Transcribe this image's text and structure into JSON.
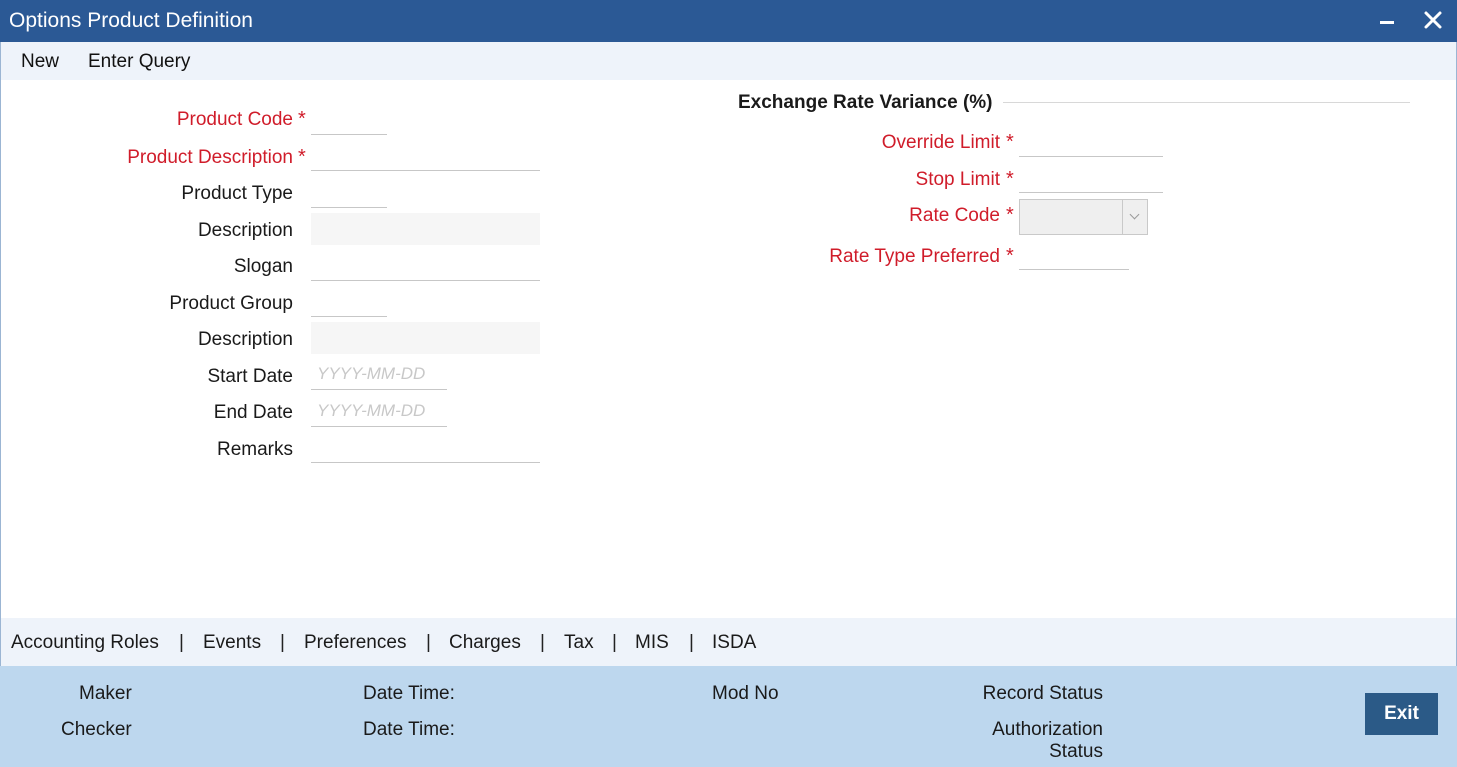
{
  "window": {
    "title": "Options Product Definition",
    "controls": {
      "minimize": "minimize-icon",
      "close": "close-icon"
    }
  },
  "menu": {
    "new": "New",
    "enter_query": "Enter Query"
  },
  "form": {
    "required_marker": "*",
    "product_code": {
      "label": "Product Code",
      "value": ""
    },
    "product_description": {
      "label": "Product Description",
      "value": ""
    },
    "product_type": {
      "label": "Product Type",
      "value": ""
    },
    "type_description": {
      "label": "Description",
      "value": ""
    },
    "slogan": {
      "label": "Slogan",
      "value": ""
    },
    "product_group": {
      "label": "Product Group",
      "value": ""
    },
    "group_description": {
      "label": "Description",
      "value": ""
    },
    "start_date": {
      "label": "Start Date",
      "placeholder": "YYYY-MM-DD",
      "value": ""
    },
    "end_date": {
      "label": "End Date",
      "placeholder": "YYYY-MM-DD",
      "value": ""
    },
    "remarks": {
      "label": "Remarks",
      "value": ""
    }
  },
  "exchange_rate": {
    "section_title": "Exchange Rate Variance (%)",
    "override_limit": {
      "label": "Override Limit",
      "value": ""
    },
    "stop_limit": {
      "label": "Stop Limit",
      "value": ""
    },
    "rate_code": {
      "label": "Rate Code",
      "value": ""
    },
    "rate_type_preferred": {
      "label": "Rate Type Preferred",
      "value": ""
    }
  },
  "tabs": {
    "separator": "|",
    "items": [
      "Accounting Roles",
      "Events",
      "Preferences",
      "Charges",
      "Tax",
      "MIS",
      "ISDA"
    ]
  },
  "audit": {
    "maker": "Maker",
    "checker": "Checker",
    "date_time_1": "Date Time:",
    "date_time_2": "Date Time:",
    "mod_no": "Mod No",
    "record_status": "Record Status",
    "authorization_status_line1": "Authorization",
    "authorization_status_line2": "Status"
  },
  "buttons": {
    "exit": "Exit"
  },
  "colors": {
    "title_bar": "#2b5995",
    "required_label": "#d01c2a",
    "footer_bg": "#bdd7ee",
    "exit_button": "#2b5a87",
    "menu_bg": "#eef3fa"
  }
}
